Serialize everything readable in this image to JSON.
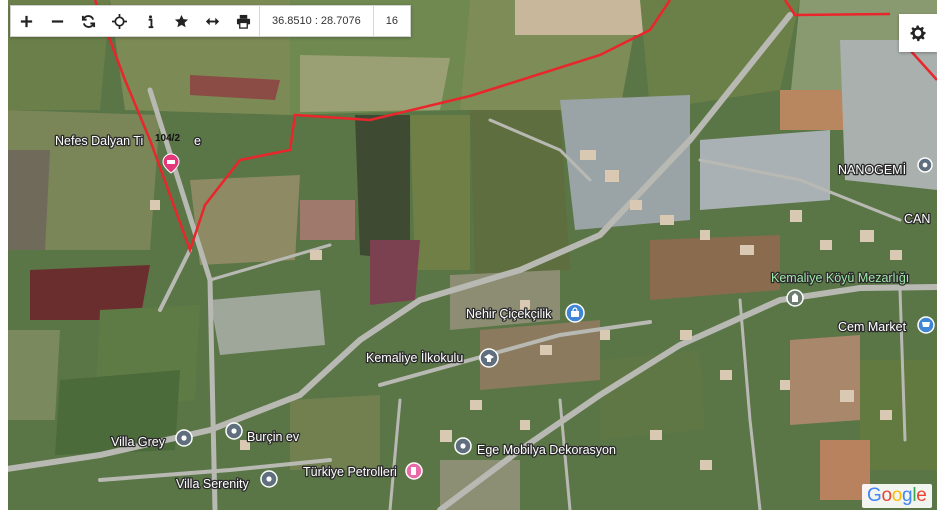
{
  "toolbar": {
    "zoom_in_icon": "plus-icon",
    "zoom_out_icon": "minus-icon",
    "refresh_icon": "refresh-icon",
    "locate_icon": "crosshair-icon",
    "info_icon": "info-icon",
    "favorite_icon": "star-icon",
    "measure_icon": "arrows-horizontal-icon",
    "print_icon": "printer-icon",
    "coordinates": "36.8510 : 28.7076",
    "zoom_level": "16"
  },
  "settings_icon": "gear-icon",
  "parcel_label": "104/2",
  "places": [
    {
      "name": "Nefes Dalyan Ti",
      "icon": "hotel-icon"
    },
    {
      "name": "e",
      "icon": ""
    },
    {
      "name": "NANOGEMİ",
      "icon": "pin-icon"
    },
    {
      "name": "CAN",
      "icon": ""
    },
    {
      "name": "Kemaliye Köyü Mezarlığı",
      "icon": "cemetery-icon"
    },
    {
      "name": "Nehir Çiçekçilik",
      "icon": "shopping-bag-icon"
    },
    {
      "name": "Cem Market",
      "icon": "cart-icon"
    },
    {
      "name": "Kemaliye İlkokulu",
      "icon": "school-icon"
    },
    {
      "name": "Villa Grey",
      "icon": "pin-icon"
    },
    {
      "name": "Burçin ev",
      "icon": "pin-icon"
    },
    {
      "name": "Ege Mobilya Dekorasyon",
      "icon": "pin-icon"
    },
    {
      "name": "Türkiye Petrolleri",
      "icon": "fuel-icon"
    },
    {
      "name": "Villa Serenity",
      "icon": "pin-icon"
    }
  ],
  "attribution": "Google",
  "colors": {
    "boundary": "#e8262b",
    "road": "#b9b9b4",
    "label_green": "#9fe8a8",
    "pin": "#5f6f7e"
  }
}
